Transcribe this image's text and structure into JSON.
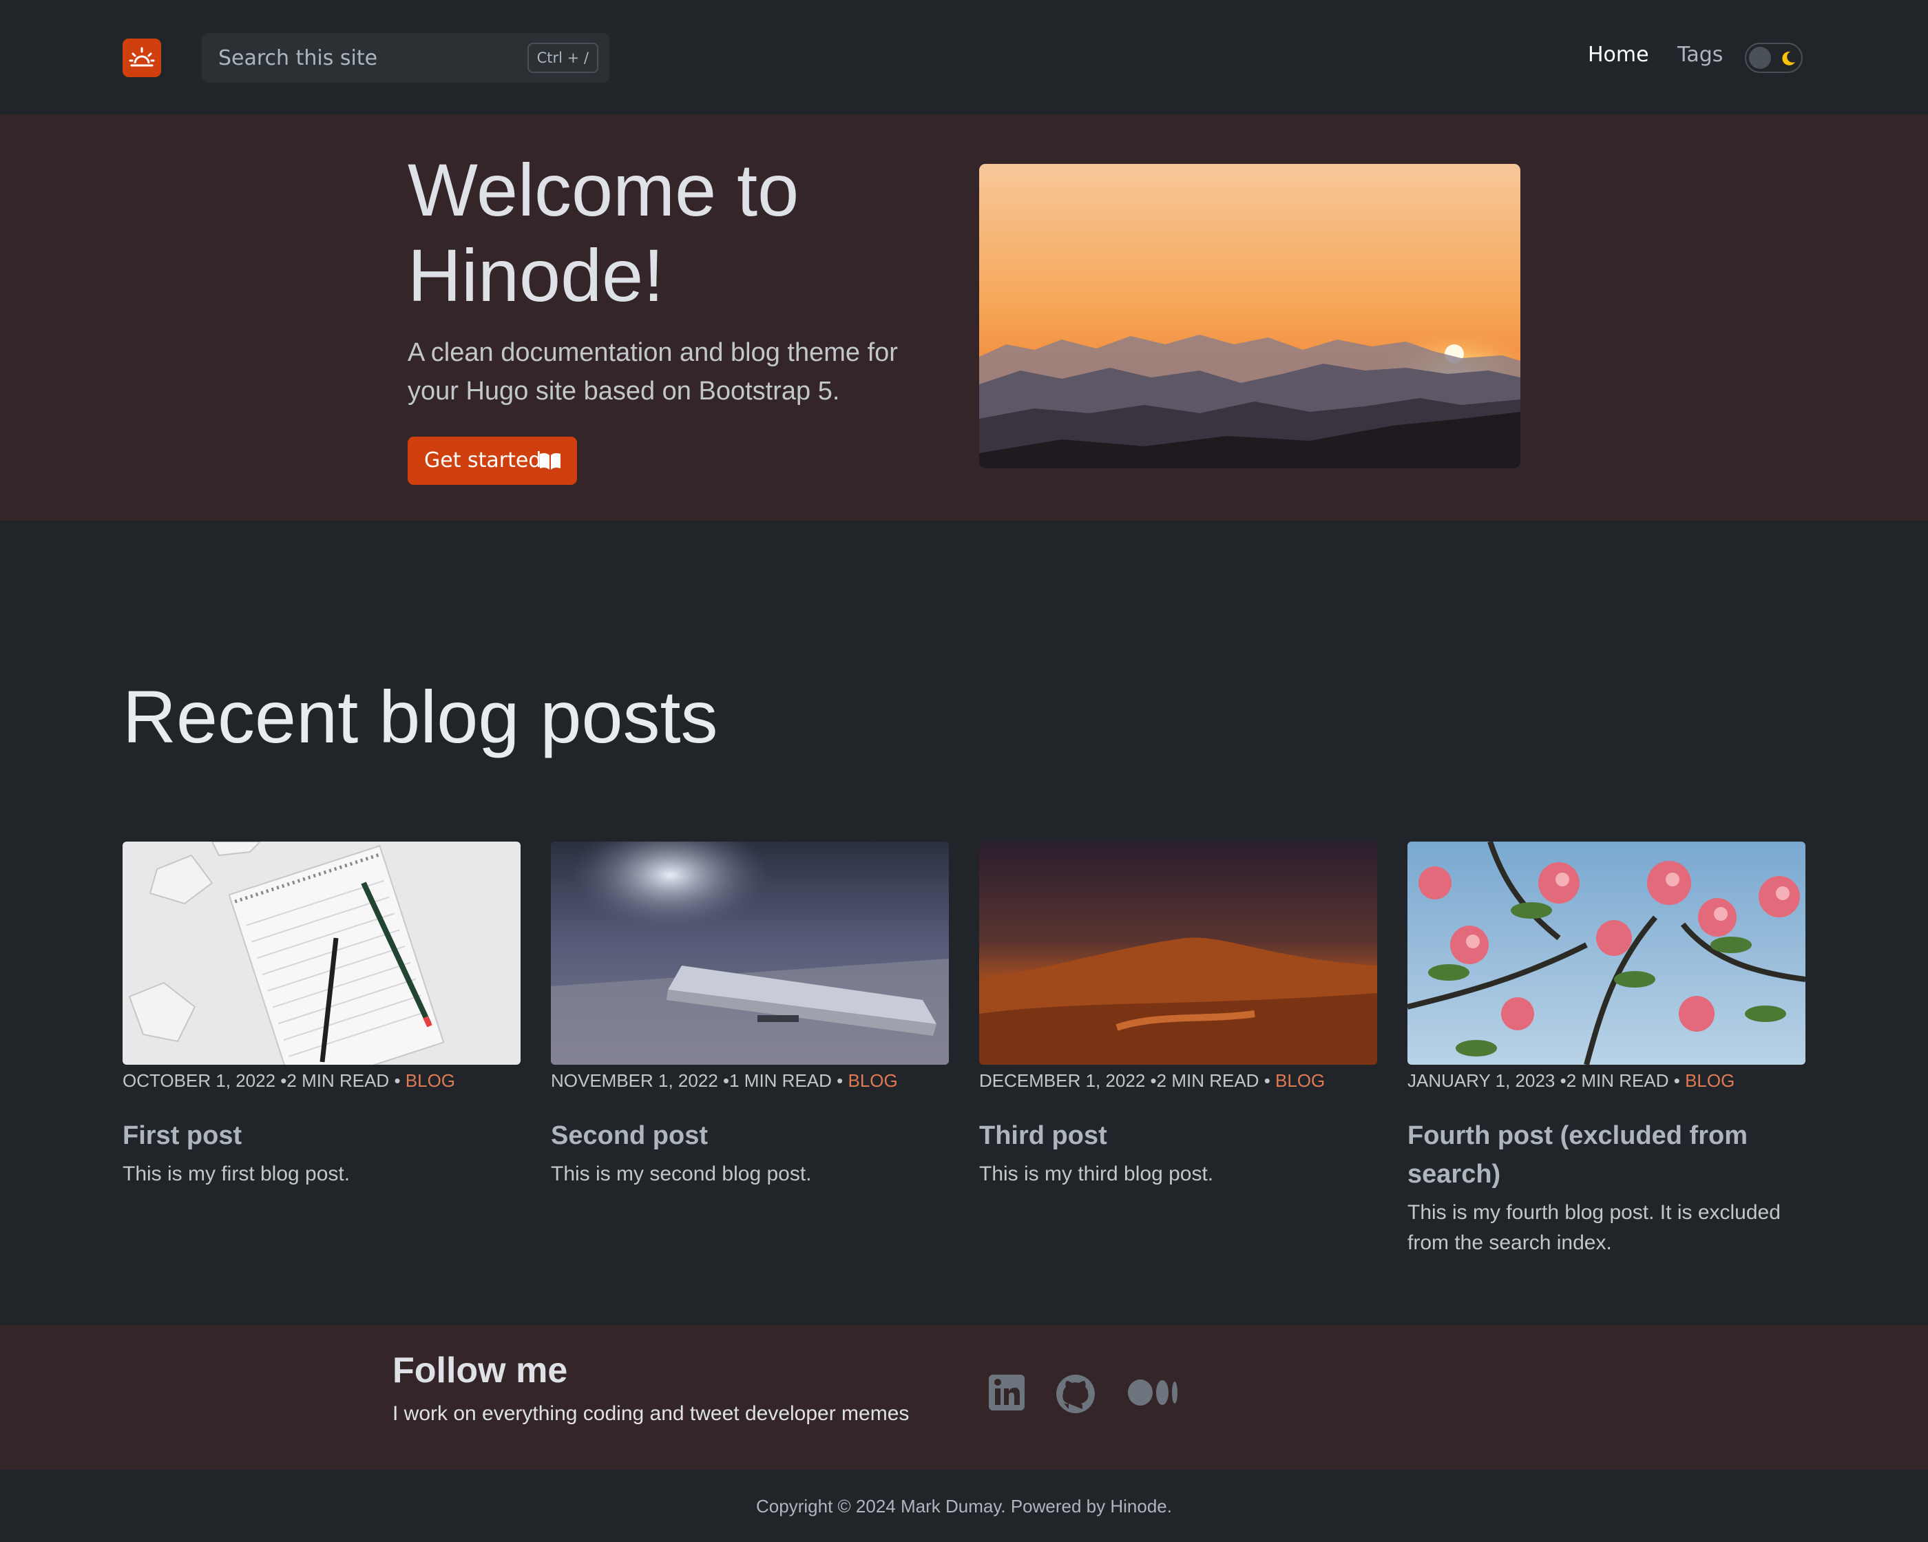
{
  "colors": {
    "accent": "#d0400e",
    "background": "#212529",
    "hero_background": "#342628",
    "category_link": "#e07a52"
  },
  "navbar": {
    "logo_icon": "sunrise-icon",
    "search": {
      "placeholder": "Search this site",
      "shortcut": "Ctrl + /"
    },
    "links": [
      {
        "label": "Home",
        "active": true
      },
      {
        "label": "Tags",
        "active": false
      }
    ],
    "theme_toggle_icon": "moon-icon"
  },
  "hero": {
    "title": "Welcome to Hinode!",
    "subtitle": "A clean documentation and blog theme for your Hugo site based on Bootstrap 5.",
    "button_label": "Get started",
    "button_icon": "book-open-icon"
  },
  "recent": {
    "title": "Recent blog posts",
    "posts": [
      {
        "date": "OCTOBER 1, 2022",
        "read": "2 MIN READ",
        "category": "BLOG",
        "title": "First post",
        "description": "This is my first blog post."
      },
      {
        "date": "NOVEMBER 1, 2022",
        "read": "1 MIN READ",
        "category": "BLOG",
        "title": "Second post",
        "description": "This is my second blog post."
      },
      {
        "date": "DECEMBER 1, 2022",
        "read": "2 MIN READ",
        "category": "BLOG",
        "title": "Third post",
        "description": "This is my third blog post."
      },
      {
        "date": "JANUARY 1, 2023",
        "read": "2 MIN READ",
        "category": "BLOG",
        "title": "Fourth post (excluded from search)",
        "description": "This is my fourth blog post. It is excluded from the search index."
      }
    ]
  },
  "follow": {
    "title": "Follow me",
    "text": "I work on everything coding and tweet developer memes",
    "icons": [
      "linkedin-icon",
      "github-icon",
      "medium-icon"
    ]
  },
  "footer": {
    "copyright": "Copyright © 2024 Mark Dumay. Powered by Hinode."
  }
}
